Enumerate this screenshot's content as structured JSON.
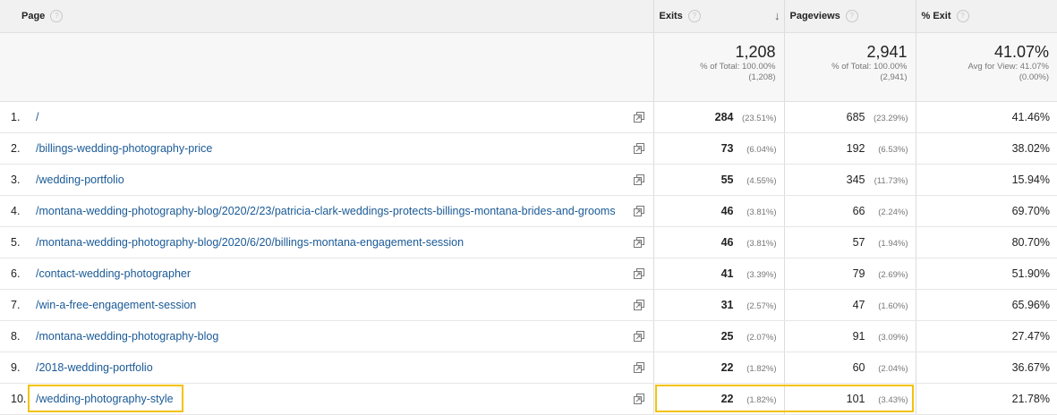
{
  "headers": {
    "page": "Page",
    "exits": "Exits",
    "pageviews": "Pageviews",
    "pct_exit": "% Exit",
    "help_glyph": "?"
  },
  "totals": {
    "exits": {
      "value": "1,208",
      "line1": "% of Total: 100.00%",
      "line2": "(1,208)"
    },
    "pageviews": {
      "value": "2,941",
      "line1": "% of Total: 100.00%",
      "line2": "(2,941)"
    },
    "pct_exit": {
      "value": "41.07%",
      "line1": "Avg for View: 41.07%",
      "line2": "(0.00%)"
    }
  },
  "rows": [
    {
      "index": "1.",
      "page": "/",
      "exits": "284",
      "exits_pct": "(23.51%)",
      "pageviews": "685",
      "pageviews_pct": "(23.29%)",
      "pct_exit": "41.46%"
    },
    {
      "index": "2.",
      "page": "/billings-wedding-photography-price",
      "exits": "73",
      "exits_pct": "(6.04%)",
      "pageviews": "192",
      "pageviews_pct": "(6.53%)",
      "pct_exit": "38.02%"
    },
    {
      "index": "3.",
      "page": "/wedding-portfolio",
      "exits": "55",
      "exits_pct": "(4.55%)",
      "pageviews": "345",
      "pageviews_pct": "(11.73%)",
      "pct_exit": "15.94%"
    },
    {
      "index": "4.",
      "page": "/montana-wedding-photography-blog/2020/2/23/patricia-clark-weddings-protects-billings-montana-brides-and-grooms",
      "exits": "46",
      "exits_pct": "(3.81%)",
      "pageviews": "66",
      "pageviews_pct": "(2.24%)",
      "pct_exit": "69.70%"
    },
    {
      "index": "5.",
      "page": "/montana-wedding-photography-blog/2020/6/20/billings-montana-engagement-session",
      "exits": "46",
      "exits_pct": "(3.81%)",
      "pageviews": "57",
      "pageviews_pct": "(1.94%)",
      "pct_exit": "80.70%"
    },
    {
      "index": "6.",
      "page": "/contact-wedding-photographer",
      "exits": "41",
      "exits_pct": "(3.39%)",
      "pageviews": "79",
      "pageviews_pct": "(2.69%)",
      "pct_exit": "51.90%"
    },
    {
      "index": "7.",
      "page": "/win-a-free-engagement-session",
      "exits": "31",
      "exits_pct": "(2.57%)",
      "pageviews": "47",
      "pageviews_pct": "(1.60%)",
      "pct_exit": "65.96%"
    },
    {
      "index": "8.",
      "page": "/montana-wedding-photography-blog",
      "exits": "25",
      "exits_pct": "(2.07%)",
      "pageviews": "91",
      "pageviews_pct": "(3.09%)",
      "pct_exit": "27.47%"
    },
    {
      "index": "9.",
      "page": "/2018-wedding-portfolio",
      "exits": "22",
      "exits_pct": "(1.82%)",
      "pageviews": "60",
      "pageviews_pct": "(2.04%)",
      "pct_exit": "36.67%"
    },
    {
      "index": "10.",
      "page": "/wedding-photography-style",
      "exits": "22",
      "exits_pct": "(1.82%)",
      "pageviews": "101",
      "pageviews_pct": "(3.43%)",
      "pct_exit": "21.78%"
    }
  ],
  "highlight_color": "#f4c20d",
  "link_color": "#1a5a96"
}
